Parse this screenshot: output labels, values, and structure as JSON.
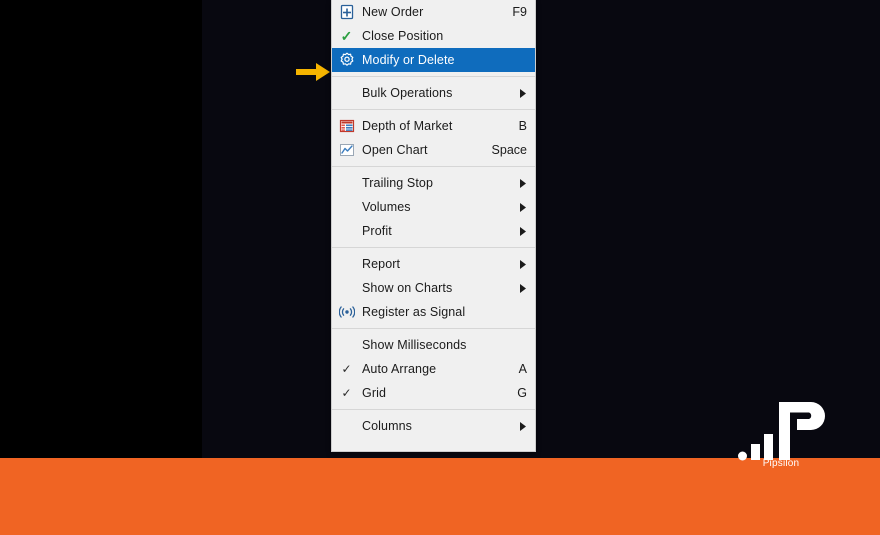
{
  "window": {
    "background_color": "#080810",
    "left_panel_color": "#000000",
    "band_color": "#F06423"
  },
  "pointer": {
    "name": "yellow-arrow-pointer",
    "color": "#F5B400",
    "points_to": "Modify or Delete"
  },
  "context_menu": {
    "accent_color": "#0f6cbd",
    "background_color": "#F0F0F0",
    "groups": [
      {
        "items": [
          {
            "label": "New Order",
            "shortcut": "F9",
            "icon": "new-order-icon",
            "icon_type": "page-plus",
            "selected": false,
            "submenu": false,
            "checked": false
          },
          {
            "label": "Close Position",
            "shortcut": "",
            "icon": "check-green-icon",
            "icon_type": "check-green",
            "selected": false,
            "submenu": false,
            "checked": false
          },
          {
            "label": "Modify or Delete",
            "shortcut": "",
            "icon": "gear-icon",
            "icon_type": "gear",
            "selected": true,
            "submenu": false,
            "checked": false
          }
        ]
      },
      {
        "items": [
          {
            "label": "Bulk Operations",
            "shortcut": "",
            "icon": "",
            "icon_type": "none",
            "selected": false,
            "submenu": true,
            "checked": false
          }
        ]
      },
      {
        "items": [
          {
            "label": "Depth of Market",
            "shortcut": "B",
            "icon": "depth-of-market-icon",
            "icon_type": "table",
            "selected": false,
            "submenu": false,
            "checked": false
          },
          {
            "label": "Open Chart",
            "shortcut": "Space",
            "icon": "open-chart-icon",
            "icon_type": "linechart",
            "selected": false,
            "submenu": false,
            "checked": false
          }
        ]
      },
      {
        "items": [
          {
            "label": "Trailing Stop",
            "shortcut": "",
            "icon": "",
            "icon_type": "none",
            "selected": false,
            "submenu": true,
            "checked": false
          },
          {
            "label": "Volumes",
            "shortcut": "",
            "icon": "",
            "icon_type": "none",
            "selected": false,
            "submenu": true,
            "checked": false
          },
          {
            "label": "Profit",
            "shortcut": "",
            "icon": "",
            "icon_type": "none",
            "selected": false,
            "submenu": true,
            "checked": false
          }
        ]
      },
      {
        "items": [
          {
            "label": "Report",
            "shortcut": "",
            "icon": "",
            "icon_type": "none",
            "selected": false,
            "submenu": true,
            "checked": false
          },
          {
            "label": "Show on Charts",
            "shortcut": "",
            "icon": "",
            "icon_type": "none",
            "selected": false,
            "submenu": true,
            "checked": false
          },
          {
            "label": "Register as Signal",
            "shortcut": "",
            "icon": "signal-icon",
            "icon_type": "signal",
            "selected": false,
            "submenu": false,
            "checked": false
          }
        ]
      },
      {
        "items": [
          {
            "label": "Show Milliseconds",
            "shortcut": "",
            "icon": "",
            "icon_type": "none",
            "selected": false,
            "submenu": false,
            "checked": false
          },
          {
            "label": "Auto Arrange",
            "shortcut": "A",
            "icon": "check-icon",
            "icon_type": "check",
            "selected": false,
            "submenu": false,
            "checked": true
          },
          {
            "label": "Grid",
            "shortcut": "G",
            "icon": "check-icon",
            "icon_type": "check",
            "selected": false,
            "submenu": false,
            "checked": true
          }
        ]
      },
      {
        "items": [
          {
            "label": "Columns",
            "shortcut": "",
            "icon": "",
            "icon_type": "none",
            "selected": false,
            "submenu": true,
            "checked": false
          }
        ]
      }
    ]
  },
  "watermark": {
    "brand": "Pipsilon",
    "color": "#FFFFFF"
  }
}
